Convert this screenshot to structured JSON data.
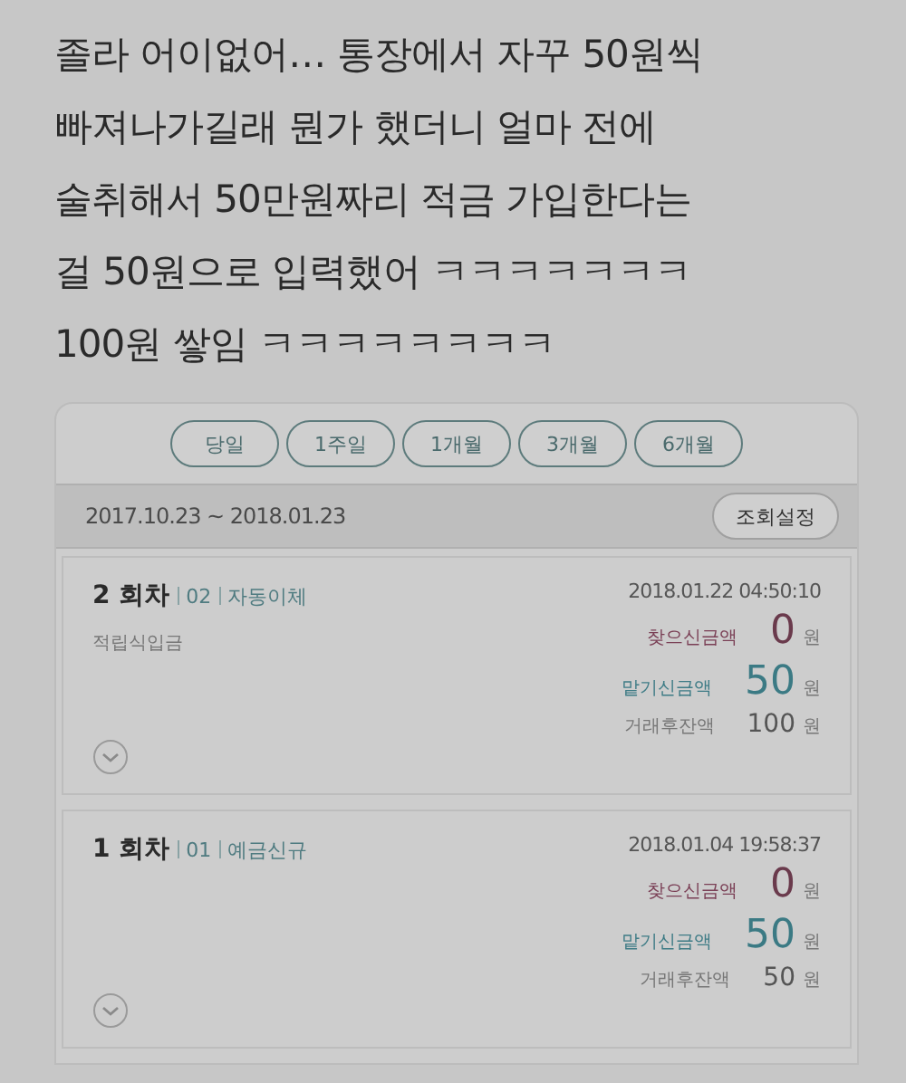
{
  "post": {
    "text": "졸라 어이없어… 통장에서 자꾸 50원씩\n빠져나가길래 뭔가 했더니 얼마 전에\n술취해서 50만원짜리 적금 가입한다는\n걸 50원으로 입력했어 ㅋㅋㅋㅋㅋㅋㅋ\n100원 쌓임 ㅋㅋㅋㅋㅋㅋㅋㅋ"
  },
  "periods": [
    "당일",
    "1주일",
    "1개월",
    "3개월",
    "6개월"
  ],
  "range": {
    "text": "2017.10.23 ~ 2018.01.23",
    "button": "조회설정"
  },
  "entries": [
    {
      "round": "2 회차",
      "code": "02",
      "type": "자동이체",
      "note": "적립식입금",
      "datetime": "2018.01.22 04:50:10",
      "amounts": [
        {
          "kind": "withdrawal",
          "label": "찾으신금액",
          "value": "0",
          "unit": "원"
        },
        {
          "kind": "deposit",
          "label": "맡기신금액",
          "value": "50",
          "unit": "원"
        },
        {
          "kind": "balance",
          "label": "거래후잔액",
          "value": "100",
          "unit": "원"
        }
      ]
    },
    {
      "round": "1 회차",
      "code": "01",
      "type": "예금신규",
      "datetime": "2018.01.04 19:58:37",
      "amounts": [
        {
          "kind": "withdrawal",
          "label": "찾으신금액",
          "value": "0",
          "unit": "원"
        },
        {
          "kind": "deposit",
          "label": "맡기신금액",
          "value": "50",
          "unit": "원"
        },
        {
          "kind": "balance",
          "label": "거래후잔액",
          "value": "50",
          "unit": "원"
        }
      ]
    }
  ]
}
